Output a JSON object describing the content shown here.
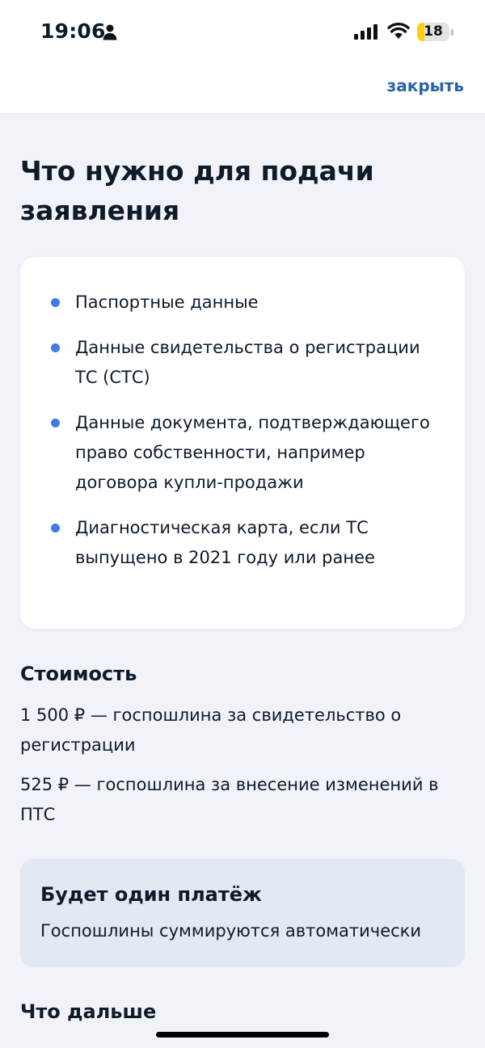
{
  "status_bar": {
    "time": "19:06",
    "battery_level": "18",
    "icons": [
      "person-icon",
      "signal-icon",
      "wifi-icon",
      "battery-icon"
    ]
  },
  "topbar": {
    "close_label": "закрыть"
  },
  "main": {
    "title": "Что нужно для подачи заявления",
    "requirements": [
      "Паспортные данные",
      "Данные свидетельства о регистрации ТС (СТС)",
      "Данные документа, подтверждающего право собственности, например договора купли-продажи",
      "Диагностическая карта, если ТС выпущено в 2021 году или ранее"
    ],
    "cost_title": "Стоимость",
    "cost_items": [
      "1 500 ₽ — госпошлина за свидетельство о регистрации",
      "525 ₽ — госпошлина за внесение изменений в ПТС"
    ],
    "info_card": {
      "title": "Будет один платёж",
      "text": "Госпошлины суммируются автоматически"
    },
    "next_title": "Что дальше"
  },
  "colors": {
    "accent": "#2a63ad",
    "bullet": "#3f7be6",
    "background": "#f1f3f8",
    "info_card": "#e3e9f2",
    "battery": "#ffd20a"
  }
}
